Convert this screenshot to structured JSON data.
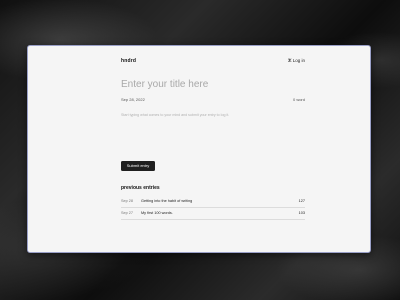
{
  "app": {
    "logo": "hndrd",
    "login_label": "ⵣ Log in"
  },
  "editor": {
    "title_placeholder": "Enter your title here",
    "date": "Sep 28, 2022",
    "word_count": "0 word",
    "body_placeholder": "Start typing what comes to your mind and submit your entry to log it."
  },
  "submit_label": "Submit entry",
  "previous": {
    "heading": "previous entries",
    "entries": [
      {
        "date": "Sep 28",
        "title": "Getting into the habit of writing",
        "count": "127"
      },
      {
        "date": "Sep 27",
        "title": "My first 100 words.",
        "count": "103"
      }
    ]
  }
}
